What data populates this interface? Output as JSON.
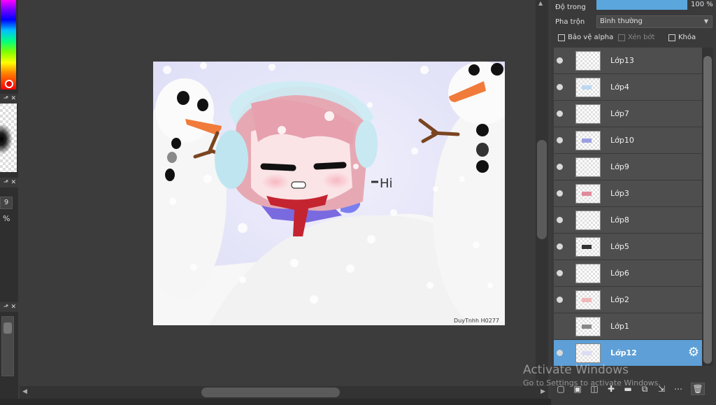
{
  "layer_props": {
    "opacity_label": "Độ trong",
    "opacity_value": "100 %",
    "opacity_fraction": 1.0,
    "blend_label": "Pha trộn",
    "blend_value": "Bình thường",
    "protect_alpha_label": "Bảo vệ alpha",
    "clip_label": "Xén bớt",
    "lock_label": "Khóa"
  },
  "layers": [
    {
      "name": "Lớp13",
      "visible": true,
      "selected": false,
      "mark": ""
    },
    {
      "name": "Lớp4",
      "visible": true,
      "selected": false,
      "mark": "#bcd8f0"
    },
    {
      "name": "Lớp7",
      "visible": true,
      "selected": false,
      "mark": ""
    },
    {
      "name": "Lớp10",
      "visible": true,
      "selected": false,
      "mark": "#9aa0e0"
    },
    {
      "name": "Lớp9",
      "visible": true,
      "selected": false,
      "mark": ""
    },
    {
      "name": "Lớp3",
      "visible": true,
      "selected": false,
      "mark": "#e08a9a"
    },
    {
      "name": "Lớp8",
      "visible": true,
      "selected": false,
      "mark": ""
    },
    {
      "name": "Lớp5",
      "visible": true,
      "selected": false,
      "mark": "#333333"
    },
    {
      "name": "Lớp6",
      "visible": true,
      "selected": false,
      "mark": ""
    },
    {
      "name": "Lớp2",
      "visible": true,
      "selected": false,
      "mark": "#f0b8b8"
    },
    {
      "name": "Lớp1",
      "visible": false,
      "selected": false,
      "mark": "#888888"
    },
    {
      "name": "Lớp12",
      "visible": true,
      "selected": true,
      "mark": "#dcdcf4"
    }
  ],
  "left_panel": {
    "size_value": "9",
    "percent_label": "%"
  },
  "artwork": {
    "speech_text": "Hi",
    "signature": "DuyTnhh H0277"
  },
  "watermark": {
    "title": "Activate Windows",
    "subtitle": "Go to Settings to activate Windows."
  },
  "icons": {
    "gear": "settings-gear-icon",
    "trash": "trash-icon"
  }
}
